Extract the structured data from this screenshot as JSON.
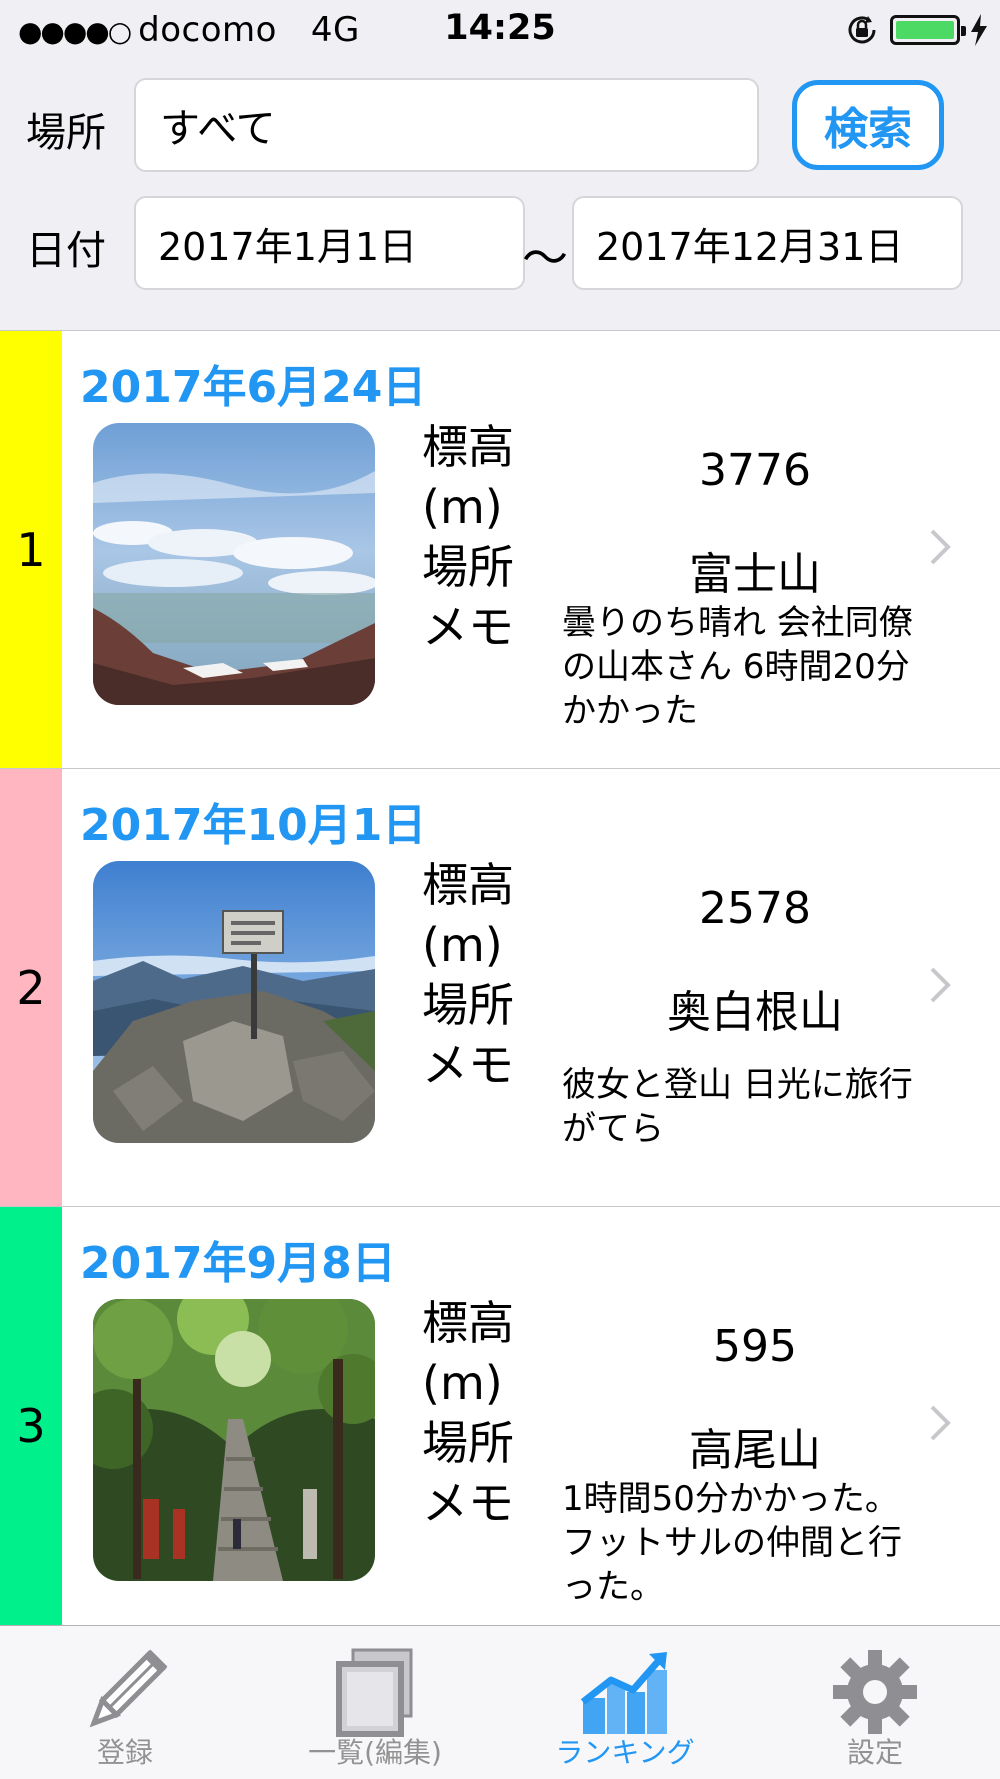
{
  "status_bar": {
    "carrier_dots": "●●●●○",
    "carrier": "docomo",
    "network": "4G",
    "time": "14:25",
    "battery_color": "#4cd964"
  },
  "search": {
    "place_label": "場所",
    "place_value": "すべて",
    "search_button": "検索",
    "date_label": "日付",
    "date_from": "2017年1月1日",
    "range_separator": "〜",
    "date_to": "2017年12月31日",
    "accent_color": "#2196f3"
  },
  "ranking": {
    "field_labels": {
      "elevation_line1": "標高",
      "elevation_line2": "(m)",
      "place": "場所",
      "memo": "メモ"
    },
    "items": [
      {
        "rank": "1",
        "rank_color": "#ffff00",
        "date": "2017年6月24日",
        "photo": "mountain-summit-clouds-photo",
        "elevation": "3776",
        "place": "富士山",
        "memo": "曇りのち晴れ 会社同僚の山本さん 6時間20分かかった"
      },
      {
        "rank": "2",
        "rank_color": "#ffb6c1",
        "date": "2017年10月1日",
        "photo": "rocky-peak-signpost-photo",
        "elevation": "2578",
        "place": "奥白根山",
        "memo": "彼女と登山 日光に旅行がてら"
      },
      {
        "rank": "3",
        "rank_color": "#00f08c",
        "date": "2017年9月8日",
        "photo": "forest-stairway-photo",
        "elevation": "595",
        "place": "高尾山",
        "memo": "1時間50分かかった。 フットサルの仲間と行った。"
      }
    ]
  },
  "tab_bar": {
    "tabs": [
      {
        "label": "登録",
        "icon": "pencil-icon",
        "active": false
      },
      {
        "label": "一覧(編集)",
        "icon": "photo-stack-icon",
        "active": false
      },
      {
        "label": "ランキング",
        "icon": "chart-icon",
        "active": true
      },
      {
        "label": "設定",
        "icon": "gear-icon",
        "active": false
      }
    ]
  }
}
